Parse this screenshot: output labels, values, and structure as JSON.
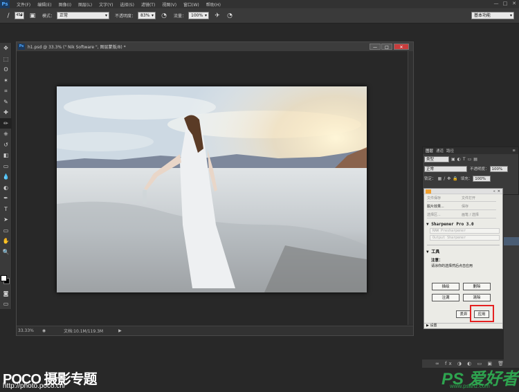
{
  "menubar": {
    "logo": "Ps",
    "items": [
      "文件(F)",
      "编辑(E)",
      "图像(I)",
      "图层(L)",
      "文字(Y)",
      "选择(S)",
      "滤镜(T)",
      "视图(V)",
      "窗口(W)",
      "帮助(H)"
    ],
    "window_controls": [
      "—",
      "□",
      "✕"
    ]
  },
  "options": {
    "brush_size": "453",
    "mode_label": "模式：",
    "mode_value": "正常",
    "opacity_label": "不透明度：",
    "opacity_value": "83%",
    "flow_label": "流量：",
    "flow_value": "100%",
    "workspace": "基本功能"
  },
  "tools": [
    "move-icon",
    "marquee-icon",
    "lasso-icon",
    "magic-wand-icon",
    "crop-icon",
    "eyedropper-icon",
    "spot-heal-icon",
    "brush-icon",
    "stamp-icon",
    "history-brush-icon",
    "eraser-icon",
    "gradient-icon",
    "blur-icon",
    "dodge-icon",
    "pen-icon",
    "type-icon",
    "path-select-icon",
    "shape-icon",
    "hand-icon",
    "zoom-icon"
  ],
  "tool_glyphs": [
    "✥",
    "⬚",
    "ʘ",
    "✶",
    "⌗",
    "✎",
    "✚",
    "✏",
    "⎈",
    "↺",
    "◧",
    "▭",
    "💧",
    "◐",
    "✒",
    "T",
    "➤",
    "▭",
    "✋",
    "🔍"
  ],
  "document": {
    "title": "h1.psd @ 33.3% (\" Nik Software \", 图层蒙版/8) *",
    "zoom": "33.33%",
    "doc_info": "文档:10.1M/119.3M"
  },
  "layers_panel": {
    "tabs": [
      "图层",
      "通道",
      "路径"
    ],
    "kind_label": "类型",
    "blend_mode": "正常",
    "opacity_label": "不透明度：",
    "opacity_value": "100%",
    "lock_label": "锁定：",
    "fill_label": "填充：",
    "fill_value": "100%"
  },
  "nik": {
    "top_buttons": [
      [
        "文件保存",
        "文件打开"
      ],
      [
        "脱片效果...",
        "保存"
      ],
      [
        "选择区...",
        "画笔 / 选择"
      ]
    ],
    "section_title": "Sharpener Pro 3.0",
    "field_1": "RAW Presharpener",
    "field_2": "Output Sharpener",
    "tools_title": "工具",
    "note_title": "注意：",
    "note_text": "请涂你的选择然后点击应用",
    "btn_paint": "描绘",
    "btn_erase": "删除",
    "btn_fill": "注满",
    "btn_clear": "清除",
    "btn_discard": "丢弃",
    "btn_apply": "应用",
    "footer": "设置"
  },
  "watermarks": {
    "poco": "POCO 摄影专题",
    "poco_url": "http://photo.poco.cn/",
    "ps": "PS 爱好者",
    "ps_url": "www.psahz.com"
  },
  "colors": {
    "highlight": "#e42020",
    "ps_green": "#2ea44f"
  }
}
